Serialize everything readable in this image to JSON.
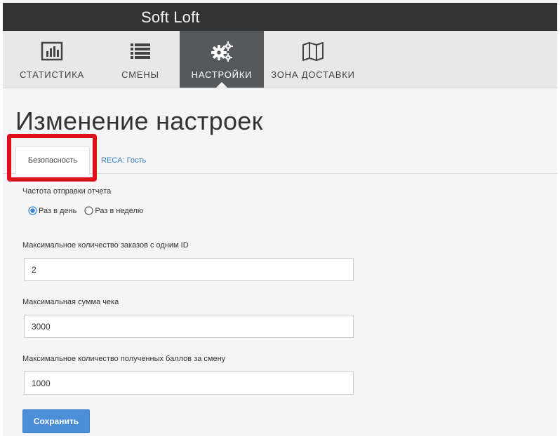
{
  "app": {
    "title": "Soft Loft"
  },
  "nav": {
    "items": [
      {
        "label": "СТАТИСТИКА",
        "icon": "bar-chart-icon",
        "active": false
      },
      {
        "label": "СМЕНЫ",
        "icon": "list-icon",
        "active": false
      },
      {
        "label": "НАСТРОЙКИ",
        "icon": "gears-icon",
        "active": true
      },
      {
        "label": "ЗОНА ДОСТАВКИ",
        "icon": "map-icon",
        "active": false
      }
    ]
  },
  "page": {
    "title": "Изменение настроек"
  },
  "tabs": {
    "active_label": "Безопасность",
    "second_label": "RECA: Гость"
  },
  "form": {
    "report_frequency": {
      "label": "Частота отправки отчета",
      "options": [
        "Раз в день",
        "Раз в неделю"
      ],
      "selected": "Раз в день"
    },
    "max_orders": {
      "label": "Максимальное количество заказов с одним ID",
      "value": "2"
    },
    "max_check": {
      "label": "Максимальная сумма чека",
      "value": "3000"
    },
    "max_points": {
      "label": "Максимальное количество полученных баллов за смену",
      "value": "1000"
    },
    "save_label": "Сохранить"
  },
  "colors": {
    "topbar": "#333333",
    "nav_active": "#56595c",
    "accent": "#4a8fd8",
    "highlight": "#e0101a",
    "link": "#3a7bbf"
  }
}
